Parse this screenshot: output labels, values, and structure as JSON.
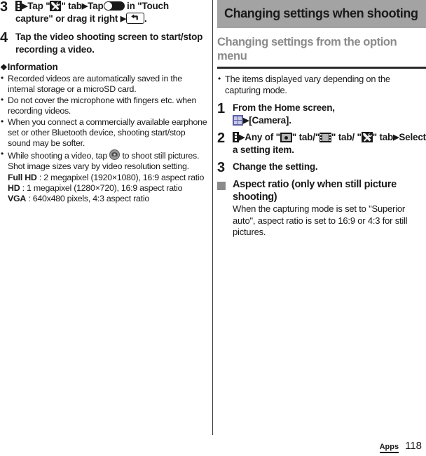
{
  "footer": {
    "tab_label": "Apps",
    "page_number": "118"
  },
  "left_column": {
    "steps": [
      {
        "number": "3",
        "text_1": "Tap \"",
        "text_2": "\" tab",
        "text_3": "Tap",
        "text_4": " in \"Touch capture\" or drag it right",
        "text_5": "."
      },
      {
        "number": "4",
        "text": "Tap the video shooting screen to start/stop recording a video."
      }
    ],
    "information": {
      "heading": "Information",
      "bullets": [
        "Recorded videos are automatically saved in the internal storage or a microSD card.",
        "Do not cover the microphone with fingers etc. when recording videos.",
        "When you connect a commercially available earphone set or other Bluetooth device, shooting start/stop sound may be softer."
      ],
      "bullet_camera": {
        "text_before": "While shooting a video, tap",
        "text_after": "to shoot still pictures. Shot image sizes vary by video resolution setting."
      },
      "specs": [
        {
          "label": "Full HD",
          "value": ": 2 megapixel (1920×1080), 16:9 aspect ratio"
        },
        {
          "label": "HD",
          "value": ": 1 megapixel (1280×720), 16:9 aspect ratio"
        },
        {
          "label": "VGA",
          "value": ": 640x480 pixels, 4:3 aspect ratio"
        }
      ]
    }
  },
  "right_column": {
    "banner_title": "Changing settings when shooting",
    "subhead": "Changing settings from the option menu",
    "note": "The items displayed vary depending on the capturing mode.",
    "steps": [
      {
        "number": "1",
        "text_1": "From the Home screen,",
        "text_2": "[Camera]."
      },
      {
        "number": "2",
        "text_1": "Any of \"",
        "text_2": "\" tab/\"",
        "text_3": "\" tab/ \"",
        "text_4": "\" tab",
        "text_5": "Select a setting item."
      },
      {
        "number": "3",
        "text": "Change the setting."
      }
    ],
    "sub_block": {
      "title": "Aspect ratio (only when still picture shooting)",
      "text": "When the capturing mode is set to \"Superior auto\", aspect ratio is set to 16:9 or 4:3 for still pictures."
    }
  },
  "colors": {
    "banner_bg": "#a3a3a3",
    "subhead_text": "#8b8b8b",
    "rule": "#2b2b2b",
    "apps_icon": "#5b5fa8",
    "body_text": "#1a1a1a"
  },
  "icons": {
    "overflow_menu": "three-dot-menu-icon",
    "tools_tab": "tools-wrench-icon",
    "toggle_off": "toggle-switch-off-icon",
    "back_key": "back-key-icon",
    "camera_shutter": "camera-shutter-icon",
    "apps_grid": "apps-grid-icon",
    "photo_tab": "photo-camera-tab-icon",
    "video_tab": "video-film-tab-icon"
  }
}
